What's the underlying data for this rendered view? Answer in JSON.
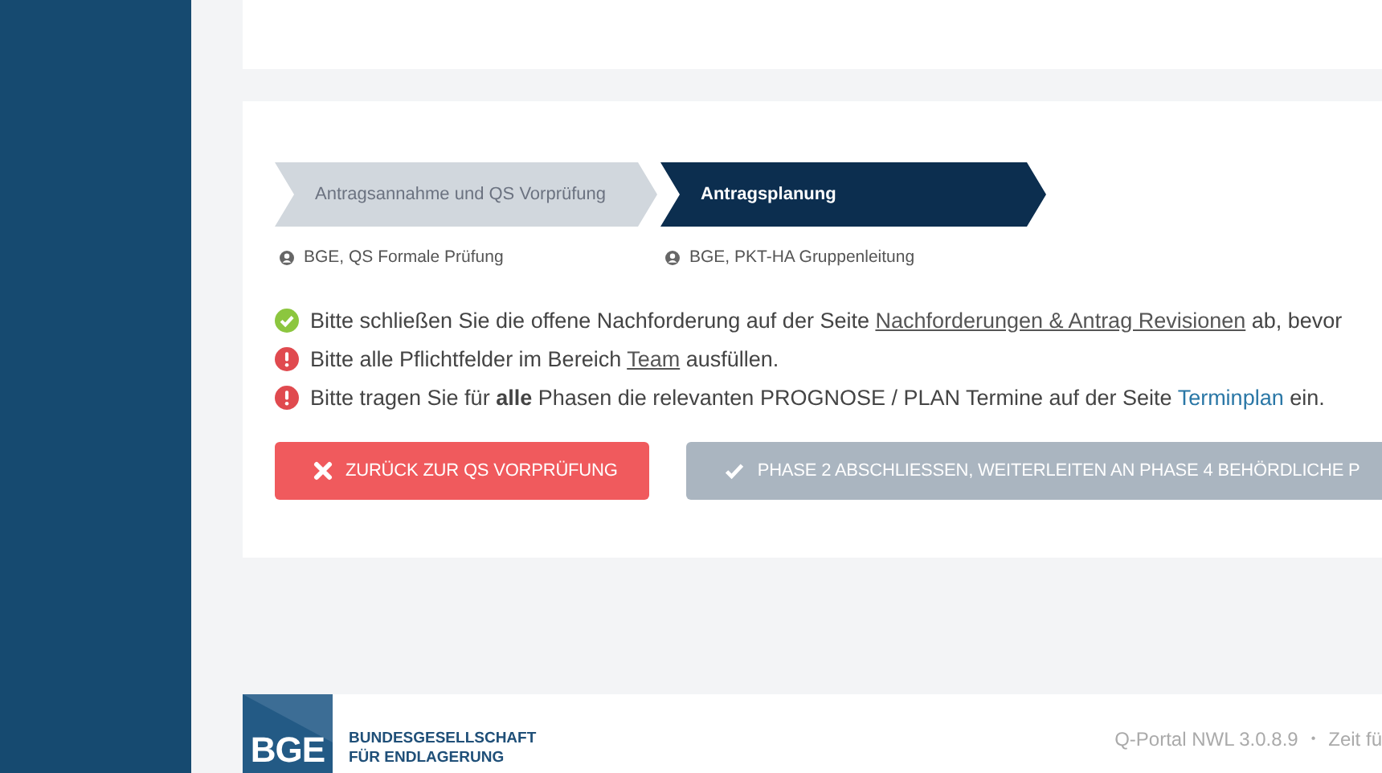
{
  "steps": [
    {
      "label": "Antragsannahme und QS Vorprüfung",
      "selected": false,
      "assignee": "BGE, QS Formale Prüfung"
    },
    {
      "label": "Antragsplanung",
      "selected": true,
      "assignee": "BGE, PKT-HA Gruppenleitung"
    }
  ],
  "messages": [
    {
      "kind": "ok",
      "parts": [
        {
          "kind": "plain",
          "text": "Bitte schließen Sie die offene Nachforderung auf der Seite "
        },
        {
          "kind": "underline",
          "text": "Nachforderungen & Antrag Revisionen"
        },
        {
          "kind": "plain",
          "text": " ab, bevor"
        }
      ]
    },
    {
      "kind": "error",
      "parts": [
        {
          "kind": "plain",
          "text": "Bitte alle Pflichtfelder im Bereich "
        },
        {
          "kind": "underline",
          "text": "Team"
        },
        {
          "kind": "plain",
          "text": " ausfüllen."
        }
      ]
    },
    {
      "kind": "error",
      "parts": [
        {
          "kind": "plain",
          "text": "Bitte tragen Sie für **alle** Phasen die relevanten PROGNOSE / PLAN Termine auf der Seite "
        },
        {
          "kind": "link",
          "text": "Terminplan"
        },
        {
          "kind": "plain",
          "text": " ein."
        }
      ]
    }
  ],
  "buttons": [
    {
      "kind": "back",
      "label": "ZURÜCK ZUR QS VORPRÜFUNG",
      "disabled": false
    },
    {
      "kind": "forward",
      "label": "PHASE 2 ABSCHLIESSEN, WEITERLEITEN AN PHASE 4 BEHÖRDLICHE P",
      "disabled": true
    }
  ],
  "footer": {
    "logo_mark": "BGE",
    "logo_line_1": "BUNDESGESELLSCHAFT",
    "logo_line_2": "FÜR ENDLAGERUNG",
    "version": "Q-Portal NWL 3.0.8.9",
    "separator": "•",
    "info": "Zeit fü"
  }
}
